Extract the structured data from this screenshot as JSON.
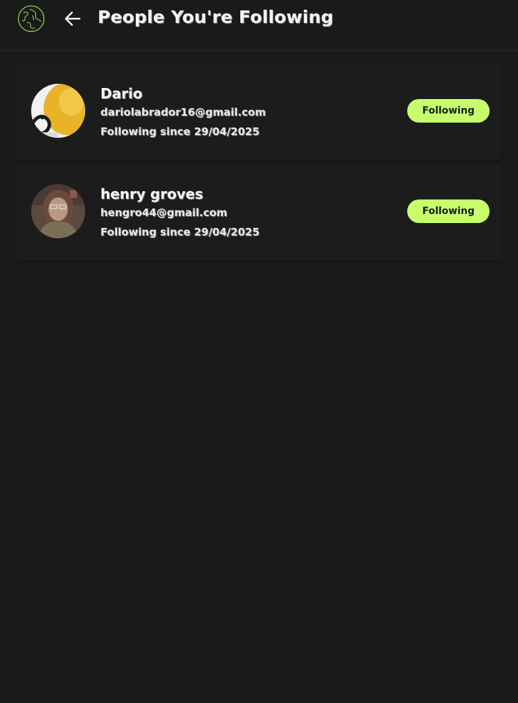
{
  "header": {
    "title": "People You're Following",
    "logo_icon": "globe-hands-logo",
    "back_icon": "arrow-left-icon"
  },
  "colors": {
    "background": "#1a1a1a",
    "accent": "#c6ff6b",
    "text": "#f5f5f5"
  },
  "following": [
    {
      "name": "Dario",
      "email": "dariolabrador16@gmail.com",
      "since": "Following since 29/04/2025",
      "button_label": "Following"
    },
    {
      "name": "henry groves",
      "email": "hengro44@gmail.com",
      "since": "Following since 29/04/2025",
      "button_label": "Following"
    }
  ]
}
